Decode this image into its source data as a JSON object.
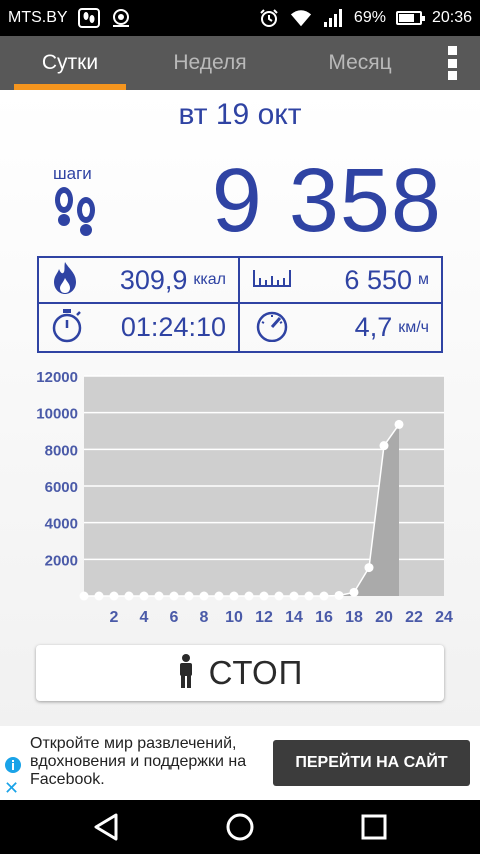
{
  "status": {
    "carrier": "MTS.BY",
    "battery": "69%",
    "battery_level": 0.69,
    "time": "20:36",
    "icons": [
      "footprint-icon",
      "location-icon",
      "alarm-icon",
      "wifi-icon",
      "signal-icon",
      "battery-icon"
    ]
  },
  "tabs": [
    {
      "label": "Сутки",
      "active": true
    },
    {
      "label": "Неделя",
      "active": false
    },
    {
      "label": "Месяц",
      "active": false
    }
  ],
  "date": "вт 19 окт",
  "steps": {
    "label": "шаги",
    "count": "9 358"
  },
  "stats": {
    "calories": {
      "value": "309,9",
      "unit": "ккал"
    },
    "distance": {
      "value": "6 550",
      "unit": "м"
    },
    "time": {
      "value": "01:24:10"
    },
    "speed": {
      "value": "4,7",
      "unit": "км/ч"
    }
  },
  "chart_data": {
    "type": "area",
    "x": [
      0,
      1,
      2,
      3,
      4,
      5,
      6,
      7,
      8,
      9,
      10,
      11,
      12,
      13,
      14,
      15,
      16,
      17,
      18,
      19,
      20,
      21
    ],
    "values": [
      0,
      0,
      0,
      0,
      0,
      0,
      0,
      0,
      0,
      0,
      0,
      0,
      0,
      0,
      0,
      0,
      0,
      30,
      200,
      1550,
      8200,
      9358
    ],
    "ylim": [
      0,
      12000
    ],
    "xlim": [
      0,
      24
    ],
    "yticks": [
      "12000",
      "10000",
      "8000",
      "6000",
      "4000",
      "2000"
    ],
    "ytick_values": [
      12000,
      10000,
      8000,
      6000,
      4000,
      2000
    ],
    "xticks": [
      "2",
      "4",
      "6",
      "8",
      "10",
      "12",
      "14",
      "16",
      "18",
      "20",
      "22",
      "24"
    ],
    "xtick_values": [
      2,
      4,
      6,
      8,
      10,
      12,
      14,
      16,
      18,
      20,
      22,
      24
    ],
    "grid": true
  },
  "stop_button": {
    "label": "СТОП"
  },
  "ad": {
    "text": "Откройте мир развлечений, вдохновения и поддержки на Facebook.",
    "cta": "ПЕРЕЙТИ НА САЙТ"
  }
}
